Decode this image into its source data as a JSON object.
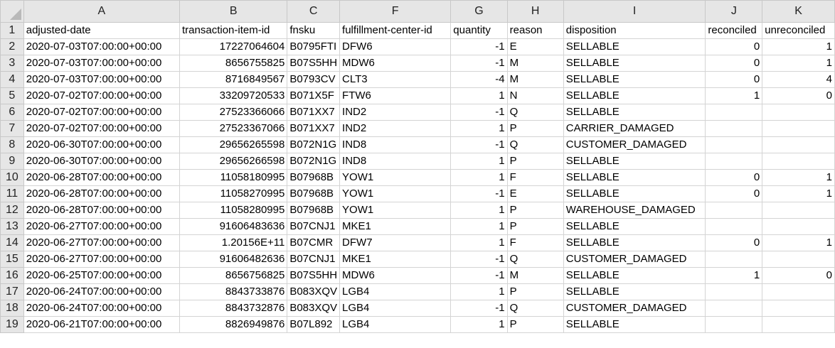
{
  "columns": [
    "A",
    "B",
    "C",
    "F",
    "G",
    "H",
    "I",
    "J",
    "K"
  ],
  "headers": [
    "adjusted-date",
    "transaction-item-id",
    "fnsku",
    "fulfillment-center-id",
    "quantity",
    "reason",
    "disposition",
    "reconciled",
    "unreconciled"
  ],
  "rows": [
    {
      "n": "2",
      "c": [
        "2020-07-03T07:00:00+00:00",
        "17227064604",
        "B0795FTI",
        "DFW6",
        "-1",
        "E",
        "SELLABLE",
        "0",
        "1"
      ]
    },
    {
      "n": "3",
      "c": [
        "2020-07-03T07:00:00+00:00",
        "8656755825",
        "B07S5HH",
        "MDW6",
        "-1",
        "M",
        "SELLABLE",
        "0",
        "1"
      ]
    },
    {
      "n": "4",
      "c": [
        "2020-07-03T07:00:00+00:00",
        "8716849567",
        "B0793CV",
        "CLT3",
        "-4",
        "M",
        "SELLABLE",
        "0",
        "4"
      ]
    },
    {
      "n": "5",
      "c": [
        "2020-07-02T07:00:00+00:00",
        "33209720533",
        "B071X5F",
        "FTW6",
        "1",
        "N",
        "SELLABLE",
        "1",
        "0"
      ]
    },
    {
      "n": "6",
      "c": [
        "2020-07-02T07:00:00+00:00",
        "27523366066",
        "B071XX7",
        "IND2",
        "-1",
        "Q",
        "SELLABLE",
        "",
        ""
      ]
    },
    {
      "n": "7",
      "c": [
        "2020-07-02T07:00:00+00:00",
        "27523367066",
        "B071XX7",
        "IND2",
        "1",
        "P",
        "CARRIER_DAMAGED",
        "",
        ""
      ]
    },
    {
      "n": "8",
      "c": [
        "2020-06-30T07:00:00+00:00",
        "29656265598",
        "B072N1G",
        "IND8",
        "-1",
        "Q",
        "CUSTOMER_DAMAGED",
        "",
        ""
      ]
    },
    {
      "n": "9",
      "c": [
        "2020-06-30T07:00:00+00:00",
        "29656266598",
        "B072N1G",
        "IND8",
        "1",
        "P",
        "SELLABLE",
        "",
        ""
      ]
    },
    {
      "n": "10",
      "c": [
        "2020-06-28T07:00:00+00:00",
        "11058180995",
        "B07968B",
        "YOW1",
        "1",
        "F",
        "SELLABLE",
        "0",
        "1"
      ]
    },
    {
      "n": "11",
      "c": [
        "2020-06-28T07:00:00+00:00",
        "11058270995",
        "B07968B",
        "YOW1",
        "-1",
        "E",
        "SELLABLE",
        "0",
        "1"
      ]
    },
    {
      "n": "12",
      "c": [
        "2020-06-28T07:00:00+00:00",
        "11058280995",
        "B07968B",
        "YOW1",
        "1",
        "P",
        "WAREHOUSE_DAMAGED",
        "",
        ""
      ]
    },
    {
      "n": "13",
      "c": [
        "2020-06-27T07:00:00+00:00",
        "91606483636",
        "B07CNJ1",
        "MKE1",
        "1",
        "P",
        "SELLABLE",
        "",
        ""
      ]
    },
    {
      "n": "14",
      "c": [
        "2020-06-27T07:00:00+00:00",
        "1.20156E+11",
        "B07CMR",
        "DFW7",
        "1",
        "F",
        "SELLABLE",
        "0",
        "1"
      ]
    },
    {
      "n": "15",
      "c": [
        "2020-06-27T07:00:00+00:00",
        "91606482636",
        "B07CNJ1",
        "MKE1",
        "-1",
        "Q",
        "CUSTOMER_DAMAGED",
        "",
        ""
      ]
    },
    {
      "n": "16",
      "c": [
        "2020-06-25T07:00:00+00:00",
        "8656756825",
        "B07S5HH",
        "MDW6",
        "-1",
        "M",
        "SELLABLE",
        "1",
        "0"
      ]
    },
    {
      "n": "17",
      "c": [
        "2020-06-24T07:00:00+00:00",
        "8843733876",
        "B083XQV",
        "LGB4",
        "1",
        "P",
        "SELLABLE",
        "",
        ""
      ]
    },
    {
      "n": "18",
      "c": [
        "2020-06-24T07:00:00+00:00",
        "8843732876",
        "B083XQV",
        "LGB4",
        "-1",
        "Q",
        "CUSTOMER_DAMAGED",
        "",
        ""
      ]
    },
    {
      "n": "19",
      "c": [
        "2020-06-21T07:00:00+00:00",
        "8826949876",
        "B07L892",
        "LGB4",
        "1",
        "P",
        "SELLABLE",
        "",
        ""
      ]
    }
  ]
}
